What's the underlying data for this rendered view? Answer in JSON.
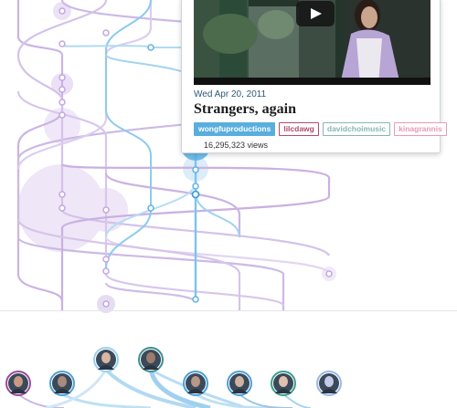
{
  "video": {
    "date": "Wed Apr 20, 2011",
    "title": "Strangers, again",
    "views": "16,295,323 views",
    "tags": [
      {
        "label": "wongfuproductions",
        "color": "#5aaede",
        "filled": true
      },
      {
        "label": "lilcdawg",
        "color": "#b24a6e",
        "filled": false
      },
      {
        "label": "davidchoimusic",
        "color": "#86b6b4",
        "filled": false
      },
      {
        "label": "kinagrannis",
        "color": "#e89ab4",
        "filled": false
      }
    ]
  },
  "colors": {
    "purple": "#c9afe2",
    "blue": "#7cc4ec",
    "highlight": "#5bb5e8",
    "bubble": "#e8dcf4"
  },
  "channels": [
    {
      "name": "channel-avatar-1",
      "ring": "#9a4a9a"
    },
    {
      "name": "channel-avatar-2",
      "ring": "#4aa0d8"
    },
    {
      "name": "channel-avatar-3",
      "ring": "#9ad0f0"
    },
    {
      "name": "channel-avatar-4",
      "ring": "#3f8f8f"
    },
    {
      "name": "channel-avatar-5",
      "ring": "#4aa0d8"
    },
    {
      "name": "channel-avatar-6",
      "ring": "#4aa0d8"
    },
    {
      "name": "channel-avatar-7",
      "ring": "#3aa08a"
    },
    {
      "name": "channel-avatar-8",
      "ring": "#9ab8e8"
    }
  ]
}
